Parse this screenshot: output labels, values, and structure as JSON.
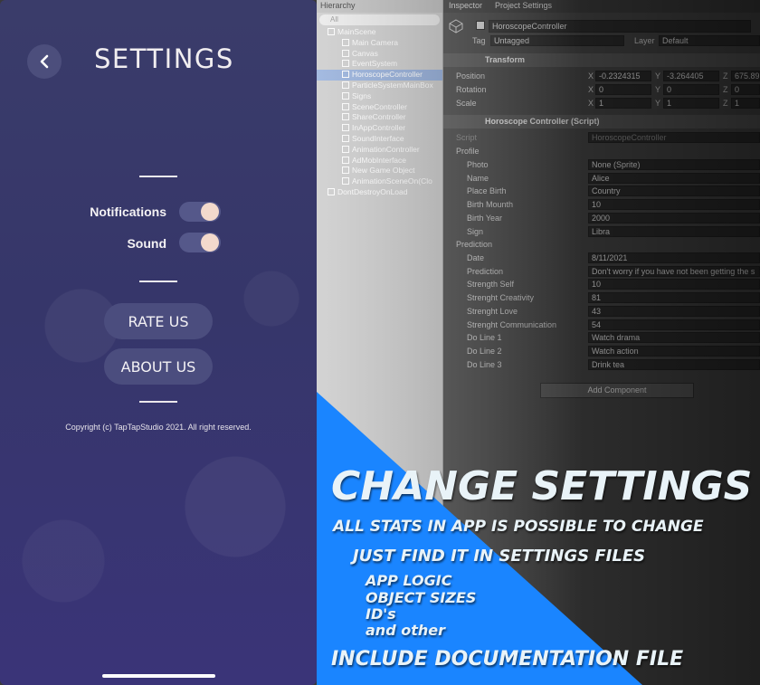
{
  "settings_screen": {
    "title": "SETTINGS",
    "notifications_label": "Notifications",
    "sound_label": "Sound",
    "rate_us_label": "RATE US",
    "about_us_label": "ABOUT US",
    "copyright": "Copyright (c) TapTapStudio 2021. All right reserved."
  },
  "hierarchy": {
    "tab": "Hierarchy",
    "search_placeholder": "All",
    "items": [
      "MainScene",
      "Main Camera",
      "Canvas",
      "EventSystem",
      "HoroscopeController",
      "ParticleSystemMainBox",
      "Signs",
      "SceneController",
      "ShareController",
      "InAppController",
      "SoundInterface",
      "AnimationController",
      "AdMobInterface",
      "New Game Object",
      "AnimationSceneOn(Clo",
      "DontDestroyOnLoad"
    ]
  },
  "inspector": {
    "tab_inspector": "Inspector",
    "tab_project": "Project Settings",
    "object_name": "HoroscopeController",
    "tag_label": "Tag",
    "tag_value": "Untagged",
    "layer_label": "Layer",
    "layer_value": "Default",
    "transform_header": "Transform",
    "position_label": "Position",
    "position": {
      "x": "-0.2324315",
      "y": "-3.264405",
      "z": "675.89"
    },
    "rotation_label": "Rotation",
    "rotation": {
      "x": "0",
      "y": "0",
      "z": "0"
    },
    "scale_label": "Scale",
    "scale": {
      "x": "1",
      "y": "1",
      "z": "1"
    },
    "script_header": "Horoscope Controller (Script)",
    "script_label": "Script",
    "script_value": "HoroscopeController",
    "profile_label": "Profile",
    "profile_fields": [
      {
        "label": "Photo",
        "value": "None (Sprite)"
      },
      {
        "label": "Name",
        "value": "Alice"
      },
      {
        "label": "Place Birth",
        "value": "Country"
      },
      {
        "label": "Birth Mounth",
        "value": "10"
      },
      {
        "label": "Birth Year",
        "value": "2000"
      },
      {
        "label": "Sign",
        "value": "Libra"
      }
    ],
    "prediction_label": "Prediction",
    "prediction_fields": [
      {
        "label": "Date",
        "value": "8/11/2021"
      },
      {
        "label": "Prediction",
        "value": "Don't worry if you have not been getting the s"
      },
      {
        "label": "Strength Self",
        "value": "10"
      },
      {
        "label": "Strenght Creativity",
        "value": "81"
      },
      {
        "label": "Strenght Love",
        "value": "43"
      },
      {
        "label": "Strenght Communication",
        "value": "54"
      },
      {
        "label": "Do Line 1",
        "value": "Watch drama"
      },
      {
        "label": "Do Line 2",
        "value": "Watch action"
      },
      {
        "label": "Do Line 3",
        "value": "Drink tea"
      }
    ],
    "add_component": "Add Component"
  },
  "promo": {
    "headline": "CHANGE SETTINGS",
    "line1": "ALL STATS IN APP IS POSSIBLE TO CHANGE",
    "line2": "JUST FIND IT IN SETTINGS FILES",
    "line3": "APP LOGIC",
    "line4": "OBJECT SIZES",
    "line5": "ID's",
    "line6": "and other",
    "line7": "INCLUDE DOCUMENTATION FILE"
  },
  "colors": {
    "accent_blue": "#1a85ff",
    "toggle_knob": "#f3d9cc",
    "phone_bg": "#3a3c6a"
  }
}
